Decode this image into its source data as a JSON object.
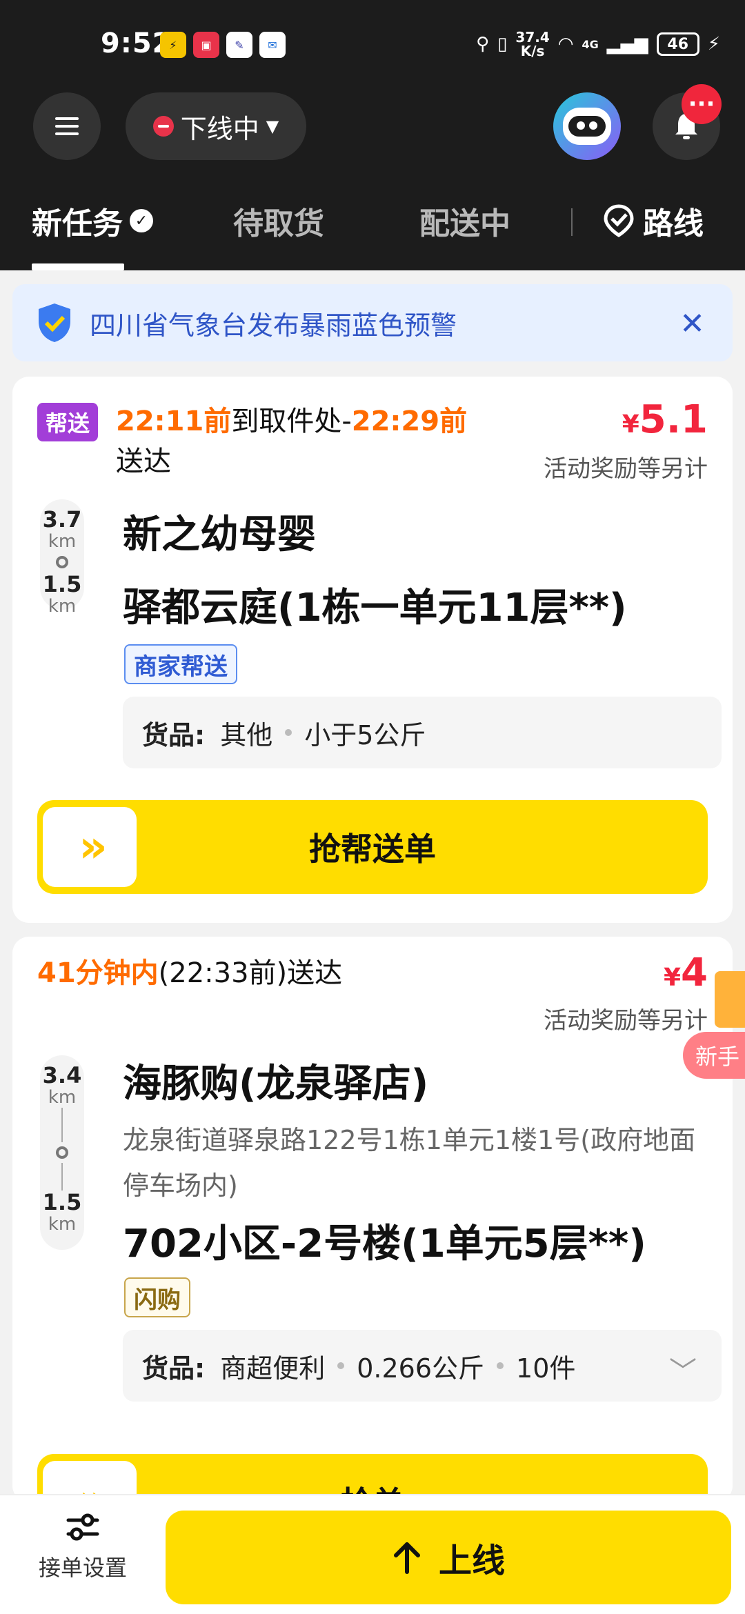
{
  "status_bar": {
    "time": "9:52",
    "net_speed_value": "37.4",
    "net_speed_unit": "K/s",
    "network": "4G",
    "battery": "46"
  },
  "header": {
    "status_label": "下线中"
  },
  "tabs": {
    "new_tasks": "新任务",
    "pending_pickup": "待取货",
    "delivering": "配送中",
    "route": "路线"
  },
  "alert": {
    "text": "四川省气象台发布暴雨蓝色预警"
  },
  "orders": [
    {
      "tag": "帮送",
      "pickup_time": "22:11前",
      "pickup_text": "到取件处-",
      "deliver_time": "22:29前",
      "deliver_text": "送达",
      "price_symbol": "¥",
      "price": "5.1",
      "reward_note": "活动奖励等另计",
      "pickup_distance": "3.7",
      "delivery_distance": "1.5",
      "distance_unit": "km",
      "pickup_name": "新之幼母婴",
      "dropoff_name": "驿都云庭(1栋一单元11层**)",
      "label": "商家帮送",
      "goods_label": "货品:",
      "goods_category": "其他",
      "goods_weight": "小于5公斤",
      "action": "抢帮送单"
    },
    {
      "deliver_time": "41分钟内",
      "deliver_text": "(22:33前)送达",
      "price_symbol": "¥",
      "price": "4",
      "reward_note": "活动奖励等另计",
      "newbie_tag": "新手",
      "pickup_distance": "3.4",
      "delivery_distance": "1.5",
      "distance_unit": "km",
      "pickup_name": "海豚购(龙泉驿店)",
      "pickup_address": "龙泉街道驿泉路122号1栋1单元1楼1号(政府地面停车场内)",
      "dropoff_name": "702小区-2号楼(1单元5层**)",
      "label": "闪购",
      "goods_label": "货品:",
      "goods_category": "商超便利",
      "goods_weight": "0.266公斤",
      "goods_count": "10件",
      "action": "抢单"
    }
  ],
  "bottom": {
    "settings_label": "接单设置",
    "online_label": "上线"
  },
  "colors": {
    "accent_yellow": "#ffdd00",
    "price_red": "#f2253d",
    "time_orange": "#ff6b00",
    "header_bg": "#1c1c1c"
  }
}
